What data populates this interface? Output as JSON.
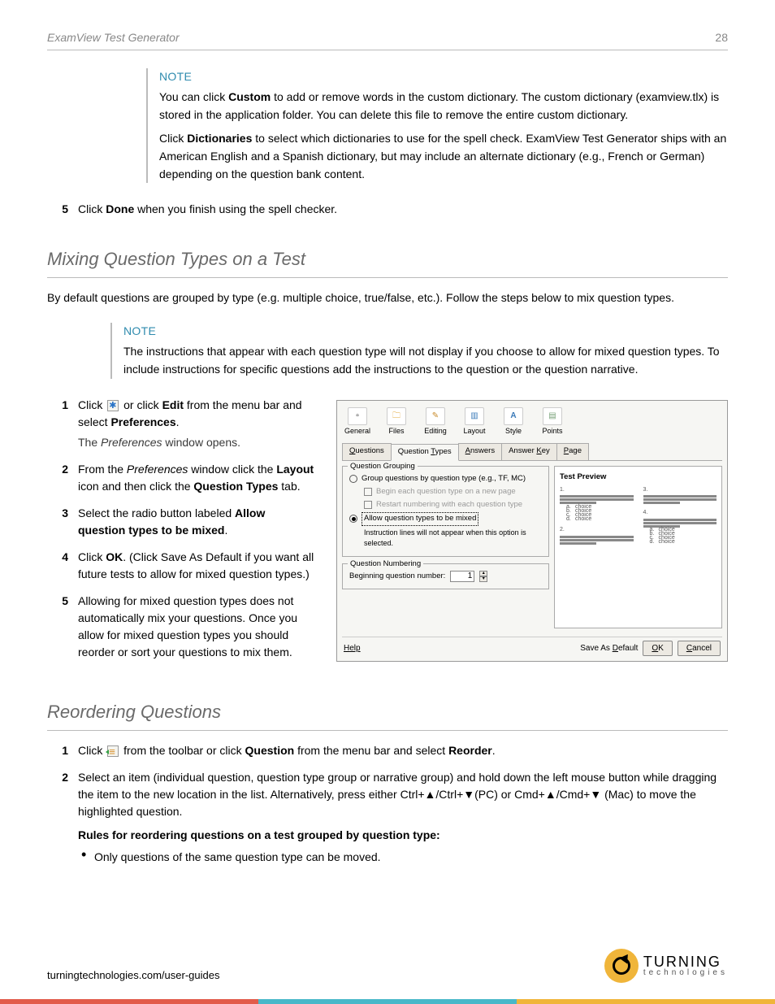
{
  "header": {
    "product": "ExamView Test Generator",
    "page_number": "28"
  },
  "note1": {
    "label": "NOTE",
    "para1_a": "You can click ",
    "para1_bold": "Custom",
    "para1_b": " to add or remove words in the custom dictionary. The custom dictionary (examview.tlx) is stored in the application folder. You can delete this file to remove the entire custom dictionary.",
    "para2_a": "Click ",
    "para2_bold": "Dictionaries",
    "para2_b": " to select which dictionaries to use for the spell check. ExamView Test Generator ships with an American English and a Spanish dictionary, but may include an alternate dictionary (e.g., French or German) depending on the question bank content."
  },
  "step_spell5": {
    "num": "5",
    "a": "Click ",
    "bold": "Done",
    "b": " when you finish using the spell checker."
  },
  "sec_mix": {
    "title": "Mixing Question Types on a Test",
    "intro": "By default questions are grouped by type (e.g. multiple choice, true/false, etc.). Follow the steps below to mix question types.",
    "note": {
      "label": "NOTE",
      "text": "The instructions that appear with each question type will not display if you choose to allow for mixed question types. To include instructions for specific questions add the instructions to the question or the question narrative."
    },
    "steps": {
      "s1": {
        "num": "1",
        "a": "Click ",
        "b": " or click ",
        "bold": "Edit",
        "c": " from the menu bar and select ",
        "bold2": "Preferences",
        "d": ".",
        "follow_a": "The ",
        "follow_em": "Preferences",
        "follow_b": " window opens."
      },
      "s2": {
        "num": "2",
        "a": "From the ",
        "em": "Preferences",
        "b": " window click the ",
        "bold": "Layout",
        "c": " icon and then click the ",
        "bold2": "Question Types",
        "d": " tab."
      },
      "s3": {
        "num": "3",
        "a": "Select the radio button labeled ",
        "bold": "Allow question types to be mixed",
        "b": "."
      },
      "s4": {
        "num": "4",
        "a": "Click ",
        "bold": "OK",
        "b": ". (Click Save As Default if you want all future tests to allow for mixed question types.)"
      },
      "s5": {
        "num": "5",
        "text": "Allowing for mixed question types does not automatically mix your questions. Once you allow for mixed question types you should reorder or sort your questions to mix them."
      }
    }
  },
  "dialog": {
    "toolbar": [
      "General",
      "Files",
      "Editing",
      "Layout",
      "Style",
      "Points"
    ],
    "toolbar_icons": [
      "▫",
      "📁",
      "✎",
      "▥",
      "A",
      "▤"
    ],
    "tabs": [
      "Questions",
      "Question Types",
      "Answers",
      "Answer Key",
      "Page"
    ],
    "group_legend": "Question Grouping",
    "radio1": "Group questions by question type (e.g., TF, MC)",
    "chk1": "Begin each question type on a new page",
    "chk2": "Restart numbering with each question type",
    "radio2": "Allow question types to be mixed",
    "hint": "Instruction lines will not appear when this option is selected.",
    "num_legend": "Question Numbering",
    "num_label": "Beginning question number:",
    "num_value": "1",
    "prev_title": "Test Preview",
    "opt": "choice",
    "help": "Help",
    "save_default": "Save As Default",
    "ok": "OK",
    "cancel": "Cancel"
  },
  "sec_reorder": {
    "title": "Reordering Questions",
    "s1": {
      "num": "1",
      "a": "Click ",
      "b": " from the toolbar or click ",
      "bold": "Question",
      "c": " from the menu bar and select ",
      "bold2": "Reorder",
      "d": "."
    },
    "s2": {
      "num": "2",
      "text": "Select an item (individual question, question type group or narrative group) and hold down the left mouse button while dragging the item to the new location in the list. Alternatively, press either Ctrl+▲/Ctrl+▼(PC) or Cmd+▲/Cmd+▼ (Mac) to move the highlighted question."
    },
    "rules_head": "Rules for reordering questions on a test grouped by question type:",
    "rule1": "Only questions of the same question type can be moved."
  },
  "footer": {
    "url": "turningtechnologies.com/user-guides",
    "logo_big": "TURNING",
    "logo_small": "technologies"
  }
}
